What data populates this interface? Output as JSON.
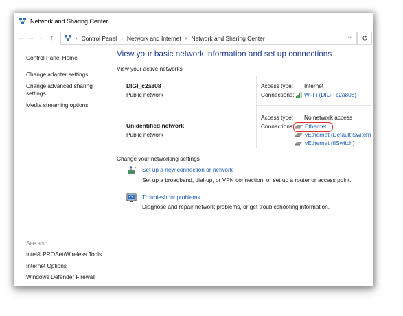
{
  "window": {
    "title": "Network and Sharing Center"
  },
  "address_bar": {
    "breadcrumbs": [
      "Control Panel",
      "Network and Internet",
      "Network and Sharing Center"
    ]
  },
  "left_pane": {
    "links": [
      "Control Panel Home",
      "Change adapter settings",
      "Change advanced sharing settings",
      "Media streaming options"
    ],
    "see_also_label": "See also",
    "see_also_links": [
      "Intel® PROSet/Wireless Tools",
      "Internet Options",
      "Windows Defender Firewall"
    ]
  },
  "main": {
    "heading": "View your basic network information and set up connections",
    "active_label": "View your active networks",
    "networks": [
      {
        "name": "DIGI_c2a808",
        "type": "Public network",
        "access_label": "Access type:",
        "access_value": "Internet",
        "connections_label": "Connections:",
        "connections": [
          "Wi-Fi (DIGI_c2a808)"
        ]
      },
      {
        "name": "Unidentified network",
        "type": "Public network",
        "access_label": "Access type:",
        "access_value": "No network access",
        "connections_label": "Connections:",
        "connections": [
          "Ethernet",
          "vEthernet (Default Switch)",
          "vEthernet (IISwitch)"
        ]
      }
    ],
    "change_label": "Change your networking settings",
    "tasks": [
      {
        "title": "Set up a new connection or network",
        "desc": "Set up a broadband, dial-up, or VPN connection; or set up a router or access point."
      },
      {
        "title": "Troubleshoot problems",
        "desc": "Diagnose and repair network problems, or get troubleshooting information."
      }
    ]
  },
  "colors": {
    "heading": "#1e3d8f",
    "link": "#1b5fb5",
    "highlight": "#e0302a"
  }
}
